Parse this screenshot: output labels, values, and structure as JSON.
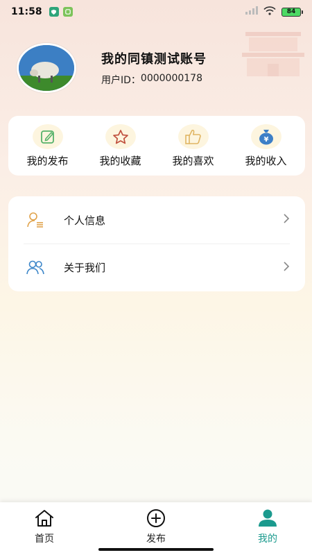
{
  "status_bar": {
    "time": "11:58",
    "battery": "84"
  },
  "profile": {
    "name": "我的同镇测试账号",
    "id_label": "用户ID：",
    "id_value": "0000000178"
  },
  "quick_actions": [
    {
      "label": "我的发布",
      "icon": "edit-icon"
    },
    {
      "label": "我的收藏",
      "icon": "star-icon"
    },
    {
      "label": "我的喜欢",
      "icon": "thumbs-up-icon"
    },
    {
      "label": "我的收入",
      "icon": "money-bag-icon"
    }
  ],
  "menu": [
    {
      "label": "个人信息",
      "icon": "person-info-icon"
    },
    {
      "label": "关于我们",
      "icon": "users-icon"
    }
  ],
  "tabbar": [
    {
      "label": "首页",
      "icon": "home-icon"
    },
    {
      "label": "发布",
      "icon": "plus-circle-icon"
    },
    {
      "label": "我的",
      "icon": "user-icon",
      "active": true
    }
  ],
  "colors": {
    "accent": "#1b9a8e",
    "icon_bg": "#fdf5df"
  }
}
